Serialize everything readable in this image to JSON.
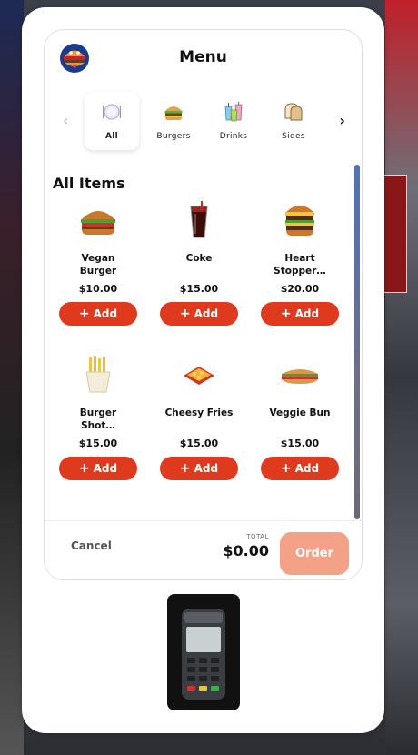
{
  "header": {
    "title": "Menu",
    "logo_icon": "burger-mascot-logo"
  },
  "categories": [
    {
      "label": "All",
      "icon": "plate-icon",
      "active": true
    },
    {
      "label": "Burgers",
      "icon": "burger-icon",
      "active": false
    },
    {
      "label": "Drinks",
      "icon": "drinks-icon",
      "active": false
    },
    {
      "label": "Sides",
      "icon": "bread-icon",
      "active": false
    }
  ],
  "section_title": "All Items",
  "add_label": "Add",
  "items": [
    {
      "name": "Vegan Burger",
      "price": "$10.00",
      "icon": "burger-image"
    },
    {
      "name": "Coke",
      "price": "$15.00",
      "icon": "cola-image"
    },
    {
      "name": "Heart Stopper…",
      "price": "$20.00",
      "icon": "double-burger-image"
    },
    {
      "name": "Burger Shot…",
      "price": "$15.00",
      "icon": "fries-image"
    },
    {
      "name": "Cheesy Fries",
      "price": "$15.00",
      "icon": "cheesy-fries-image"
    },
    {
      "name": "Veggie Bun",
      "price": "$15.00",
      "icon": "sandwich-image"
    }
  ],
  "footer": {
    "cancel_label": "Cancel",
    "total_label": "TOTAL",
    "total_value": "$0.00",
    "order_label": "Order"
  },
  "scrollbar": {
    "thumb_fraction": 1.0
  },
  "colors": {
    "accent": "#e03a1e",
    "order_disabled": "#f3a287"
  }
}
